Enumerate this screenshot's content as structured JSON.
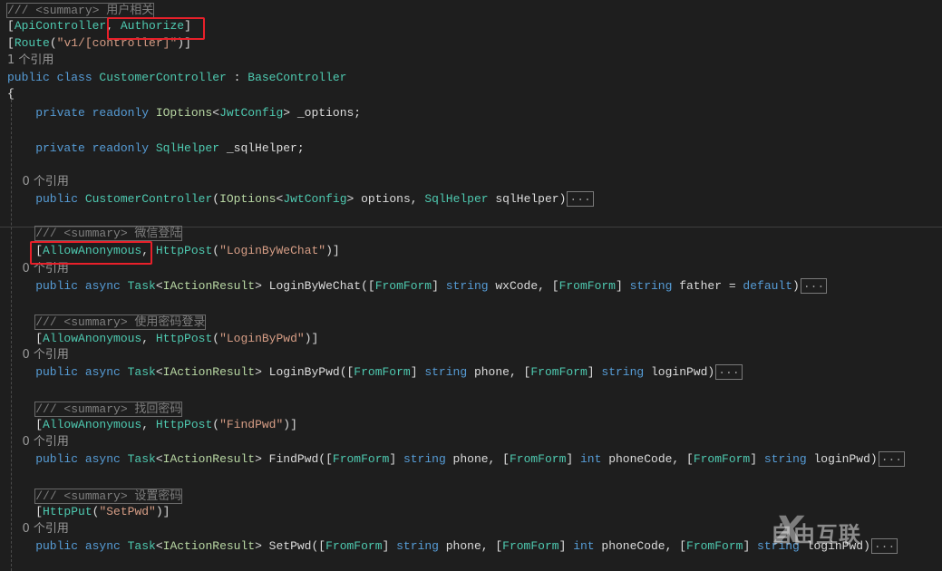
{
  "editor": {
    "lines": [
      [
        [
          "c sum",
          "/// <summary> 用户相关"
        ]
      ],
      [
        [
          "p",
          "["
        ],
        [
          "t",
          "ApiController"
        ],
        [
          "p",
          ", "
        ],
        [
          "t",
          "Authorize"
        ],
        [
          "p",
          "]"
        ]
      ],
      [
        [
          "p",
          "["
        ],
        [
          "t",
          "Route"
        ],
        [
          "p",
          "("
        ],
        [
          "s",
          "\"v1/[controller]\""
        ],
        [
          "p",
          ")]"
        ]
      ],
      [
        [
          "l",
          "1 个引用"
        ]
      ],
      [
        [
          "k",
          "public class "
        ],
        [
          "t",
          "CustomerController"
        ],
        [
          "p",
          " : "
        ],
        [
          "t",
          "BaseController"
        ]
      ],
      [
        [
          "p",
          "{"
        ]
      ],
      [
        [
          "k",
          "    private readonly "
        ],
        [
          "i",
          "IOptions"
        ],
        [
          "p",
          "<"
        ],
        [
          "t",
          "JwtConfig"
        ],
        [
          "p",
          "> _options;"
        ]
      ],
      [
        [
          "k",
          "    private readonly "
        ],
        [
          "t",
          "SqlHelper"
        ],
        [
          "p",
          " _sqlHelper;"
        ]
      ],
      [
        [
          "l",
          "    0 个引用"
        ]
      ],
      [
        [
          "k",
          "    public "
        ],
        [
          "t",
          "CustomerController"
        ],
        [
          "p",
          "("
        ],
        [
          "i",
          "IOptions"
        ],
        [
          "p",
          "<"
        ],
        [
          "t",
          "JwtConfig"
        ],
        [
          "p",
          "> options, "
        ],
        [
          "t",
          "SqlHelper"
        ],
        [
          "p",
          " sqlHelper)"
        ],
        [
          "dots",
          "..."
        ]
      ],
      [
        [
          "p",
          "    "
        ],
        [
          "c sum",
          "/// <summary> 微信登陆"
        ]
      ],
      [
        [
          "p",
          "    ["
        ],
        [
          "t",
          "AllowAnonymous"
        ],
        [
          "p",
          ", "
        ],
        [
          "t",
          "HttpPost"
        ],
        [
          "p",
          "("
        ],
        [
          "s",
          "\"LoginByWeChat\""
        ],
        [
          "p",
          ")]"
        ]
      ],
      [
        [
          "l",
          "    0 个引用"
        ]
      ],
      [
        [
          "k",
          "    public async "
        ],
        [
          "t",
          "Task"
        ],
        [
          "p",
          "<"
        ],
        [
          "i",
          "IActionResult"
        ],
        [
          "p",
          "> LoginByWeChat(["
        ],
        [
          "t",
          "FromForm"
        ],
        [
          "p",
          "] "
        ],
        [
          "k",
          "string"
        ],
        [
          "p",
          " wxCode, ["
        ],
        [
          "t",
          "FromForm"
        ],
        [
          "p",
          "] "
        ],
        [
          "k",
          "string"
        ],
        [
          "p",
          " father = "
        ],
        [
          "k",
          "default"
        ],
        [
          "p",
          ")"
        ],
        [
          "dots",
          "..."
        ]
      ],
      [
        [
          "p",
          "    "
        ],
        [
          "c sum",
          "/// <summary> 使用密码登录"
        ]
      ],
      [
        [
          "p",
          "    ["
        ],
        [
          "t",
          "AllowAnonymous"
        ],
        [
          "p",
          ", "
        ],
        [
          "t",
          "HttpPost"
        ],
        [
          "p",
          "("
        ],
        [
          "s",
          "\"LoginByPwd\""
        ],
        [
          "p",
          ")]"
        ]
      ],
      [
        [
          "l",
          "    0 个引用"
        ]
      ],
      [
        [
          "k",
          "    public async "
        ],
        [
          "t",
          "Task"
        ],
        [
          "p",
          "<"
        ],
        [
          "i",
          "IActionResult"
        ],
        [
          "p",
          "> LoginByPwd(["
        ],
        [
          "t",
          "FromForm"
        ],
        [
          "p",
          "] "
        ],
        [
          "k",
          "string"
        ],
        [
          "p",
          " phone, ["
        ],
        [
          "t",
          "FromForm"
        ],
        [
          "p",
          "] "
        ],
        [
          "k",
          "string"
        ],
        [
          "p",
          " loginPwd)"
        ],
        [
          "dots",
          "..."
        ]
      ],
      [
        [
          "p",
          "    "
        ],
        [
          "c sum",
          "/// <summary> 找回密码"
        ]
      ],
      [
        [
          "p",
          "    ["
        ],
        [
          "t",
          "AllowAnonymous"
        ],
        [
          "p",
          ", "
        ],
        [
          "t",
          "HttpPost"
        ],
        [
          "p",
          "("
        ],
        [
          "s",
          "\"FindPwd\""
        ],
        [
          "p",
          ")]"
        ]
      ],
      [
        [
          "l",
          "    0 个引用"
        ]
      ],
      [
        [
          "k",
          "    public async "
        ],
        [
          "t",
          "Task"
        ],
        [
          "p",
          "<"
        ],
        [
          "i",
          "IActionResult"
        ],
        [
          "p",
          "> FindPwd(["
        ],
        [
          "t",
          "FromForm"
        ],
        [
          "p",
          "] "
        ],
        [
          "k",
          "string"
        ],
        [
          "p",
          " phone, ["
        ],
        [
          "t",
          "FromForm"
        ],
        [
          "p",
          "] "
        ],
        [
          "k",
          "int"
        ],
        [
          "p",
          " phoneCode, ["
        ],
        [
          "t",
          "FromForm"
        ],
        [
          "p",
          "] "
        ],
        [
          "k",
          "string"
        ],
        [
          "p",
          " loginPwd)"
        ],
        [
          "dots",
          "..."
        ]
      ],
      [
        [
          "p",
          "    "
        ],
        [
          "c sum",
          "/// <summary> 设置密码"
        ]
      ],
      [
        [
          "p",
          "    ["
        ],
        [
          "t",
          "HttpPut"
        ],
        [
          "p",
          "("
        ],
        [
          "s",
          "\"SetPwd\""
        ],
        [
          "p",
          ")]"
        ]
      ],
      [
        [
          "l",
          "    0 个引用"
        ]
      ],
      [
        [
          "k",
          "    public async "
        ],
        [
          "t",
          "Task"
        ],
        [
          "p",
          "<"
        ],
        [
          "i",
          "IActionResult"
        ],
        [
          "p",
          "> SetPwd(["
        ],
        [
          "t",
          "FromForm"
        ],
        [
          "p",
          "] "
        ],
        [
          "k",
          "string"
        ],
        [
          "p",
          " phone, ["
        ],
        [
          "t",
          "FromForm"
        ],
        [
          "p",
          "] "
        ],
        [
          "k",
          "int"
        ],
        [
          "p",
          " phoneCode, ["
        ],
        [
          "t",
          "FromForm"
        ],
        [
          "p",
          "] "
        ],
        [
          "k",
          "string"
        ],
        [
          "p",
          " loginPwd)"
        ],
        [
          "dots",
          "..."
        ]
      ]
    ]
  },
  "watermark": {
    "text": "自由互联",
    "mark": "X"
  },
  "colors": {
    "background": "#1e1e1e",
    "keyword": "#569cd6",
    "type": "#4ec9b0",
    "string": "#d69d85",
    "highlight": "#e8202a"
  }
}
